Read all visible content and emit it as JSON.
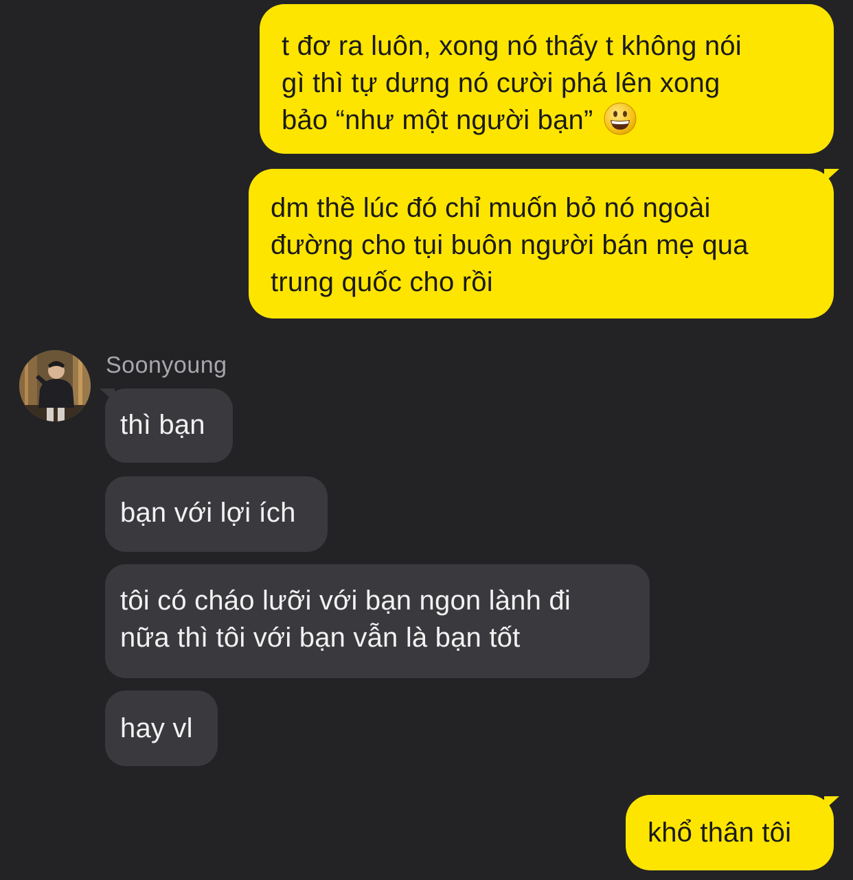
{
  "messages": [
    {
      "side": "out",
      "lines": [
        "t đơ ra luôn, xong nó thấy t không nói",
        "gì thì tự dưng nó cười phá lên xong",
        "bảo “như một người bạn”"
      ],
      "emoji": "grinning-face-icon"
    },
    {
      "side": "out",
      "lines": [
        "dm thề lúc đó chỉ muốn bỏ nó ngoài",
        "đường cho tụi buôn người bán mẹ qua",
        "trung quốc cho rồi"
      ]
    },
    {
      "side": "in",
      "lines": [
        "thì bạn"
      ]
    },
    {
      "side": "in",
      "lines": [
        "bạn với lợi ích"
      ]
    },
    {
      "side": "in",
      "lines": [
        "tôi có cháo lưỡi với bạn ngon lành đi",
        "nữa thì tôi với bạn vẫn là bạn tốt"
      ]
    },
    {
      "side": "in",
      "lines": [
        "hay vl"
      ]
    },
    {
      "side": "out",
      "lines": [
        "khổ thân tôi"
      ]
    }
  ],
  "contact": {
    "name": "Soonyoung",
    "avatar": "avatar-photo"
  },
  "colors": {
    "background": "#232326",
    "outgoing_bubble": "#fee500",
    "incoming_bubble": "#3a3a3e",
    "sender_name": "#a7a7ac"
  }
}
